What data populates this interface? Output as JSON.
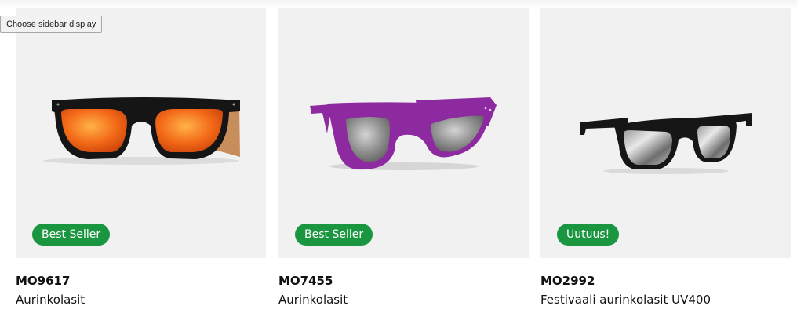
{
  "tooltip": {
    "text": "Choose sidebar display"
  },
  "colors": {
    "badge_bg": "#1a9641",
    "card_bg": "#f1f1f1"
  },
  "products": [
    {
      "code": "MO9617",
      "name": "Aurinkolasit",
      "badge": "Best Seller",
      "image": "black-orange-mirror-sunglasses"
    },
    {
      "code": "MO7455",
      "name": "Aurinkolasit",
      "badge": "Best Seller",
      "image": "purple-sunglasses"
    },
    {
      "code": "MO2992",
      "name": "Festivaali aurinkolasit UV400",
      "badge": "Uutuus!",
      "image": "black-silver-mirror-sunglasses"
    }
  ]
}
